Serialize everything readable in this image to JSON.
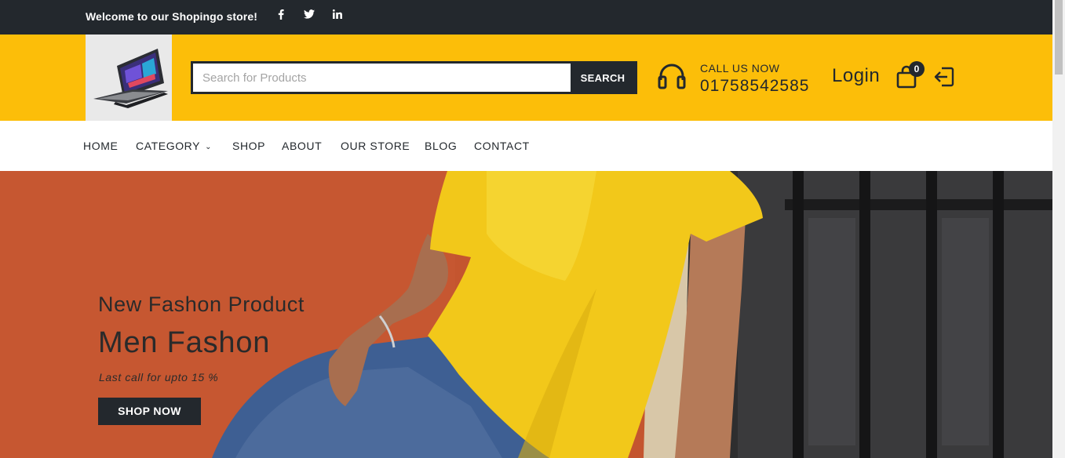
{
  "topbar": {
    "welcome": "Welcome to our Shopingo store!",
    "social": [
      {
        "name": "facebook",
        "label": "f"
      },
      {
        "name": "twitter",
        "label": "twitter"
      },
      {
        "name": "linkedin",
        "label": "in"
      }
    ]
  },
  "header": {
    "logo_alt": "laptop-logo",
    "search": {
      "placeholder": "Search for Products",
      "button_label": "SEARCH"
    },
    "call": {
      "label": "CALL US NOW",
      "number": "01758542585"
    },
    "login_label": "Login",
    "cart_count": "0"
  },
  "nav": {
    "items": [
      {
        "label": "HOME"
      },
      {
        "label": "CATEGORY",
        "has_dropdown": true
      },
      {
        "label": "SHOP"
      },
      {
        "label": "ABOUT"
      },
      {
        "label": "OUR STORE"
      },
      {
        "label": "BLOG"
      },
      {
        "label": "CONTACT"
      }
    ]
  },
  "hero": {
    "subtitle": "New Fashon Product",
    "title": "Men Fashon",
    "note": "Last call for upto 15 %",
    "button_label": "SHOP NOW"
  },
  "colors": {
    "accent": "#fcbe09",
    "dark": "#23282d",
    "hero_wall": "#c4552f",
    "shirt": "#f2c81a",
    "jeans": "#3e5f93"
  }
}
